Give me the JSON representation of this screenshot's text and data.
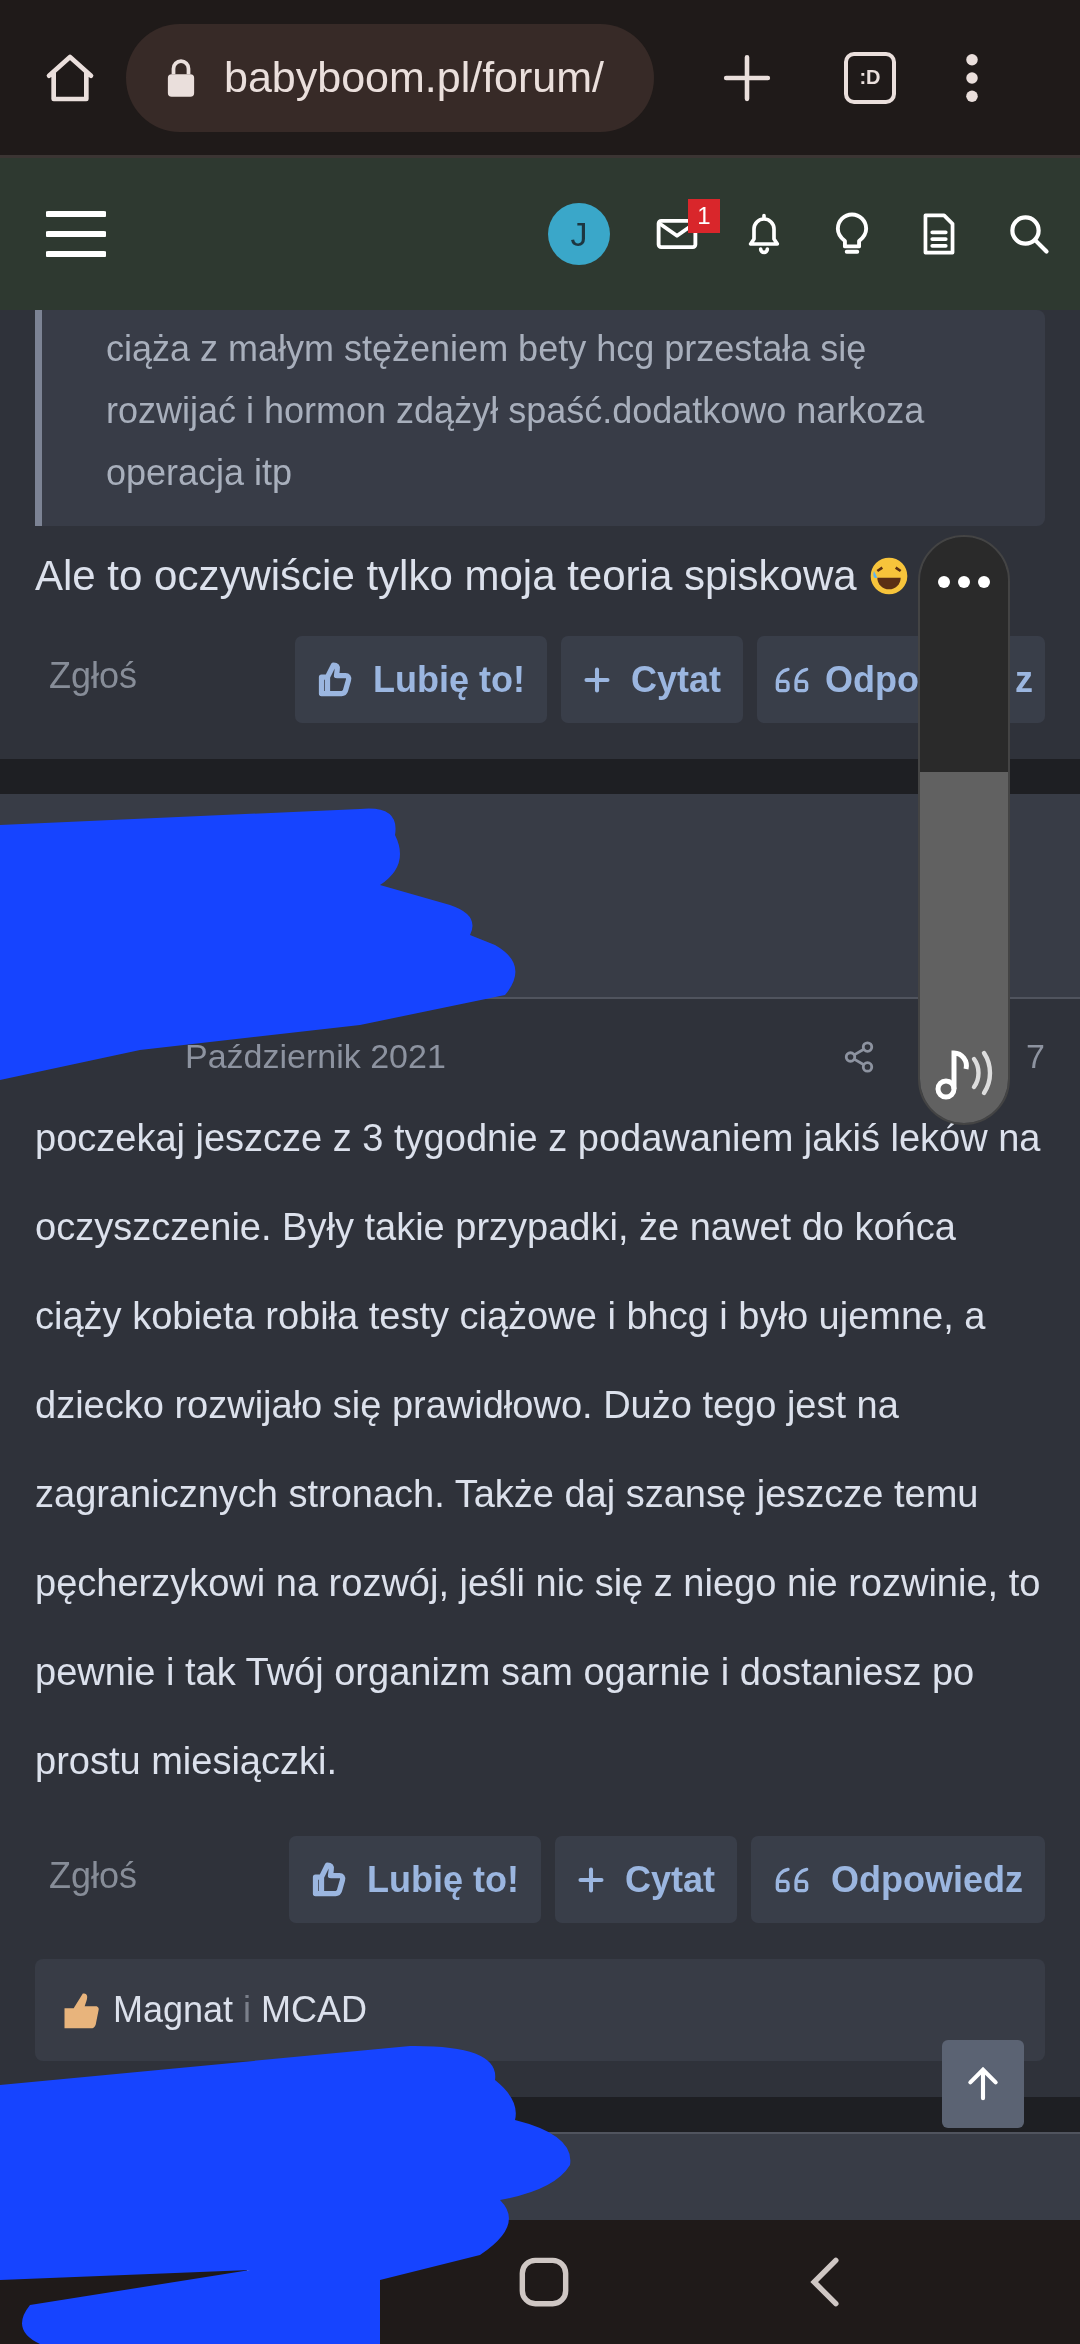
{
  "browser": {
    "url": "babyboom.pl/forum/",
    "tab_count": ":D"
  },
  "forum_header": {
    "avatar_letter": "J",
    "unread_messages": "1"
  },
  "posts": [
    {
      "quote": [
        "ciąża z małym stężeniem bety hcg przestała się",
        "rozwijać i hormon zdążył spaść.dodatkowo narkoza",
        "operacja itp"
      ],
      "body": "Ale to oczywiście tylko moja teoria spiskowa",
      "report": "Zgłoś",
      "actions": [
        {
          "kind": "like",
          "label": "Lubię to!"
        },
        {
          "kind": "quote",
          "label": "Cytat"
        },
        {
          "kind": "reply",
          "label": "Odpo",
          "label_tail": "z"
        }
      ]
    },
    {
      "date": "Październik 2021",
      "post_number": "7",
      "body": "poczekaj jeszcze z 3 tygodnie z podawaniem jakiś leków na oczyszczenie. Były takie przypadki, że nawet do końca ciąży kobieta robiła testy ciążowe i bhcg i było ujemne, a dziecko rozwijało się prawidłowo. Dużo tego jest na zagranicznych stronach. Także daj szansę jeszcze temu pęcherzykowi na rozwój, jeśli nic się z niego nie rozwinie, to pewnie i tak Twój organizm sam ogarnie i dostaniesz po prostu miesiączki.",
      "report": "Zgłoś",
      "actions": [
        {
          "kind": "like",
          "label": "Lubię to!"
        },
        {
          "kind": "quote",
          "label": "Cytat"
        },
        {
          "kind": "reply",
          "label": "Odpowiedz"
        }
      ],
      "reactions": {
        "users": [
          "Magnat",
          "MCAD"
        ],
        "joiner": "i"
      }
    }
  ]
}
